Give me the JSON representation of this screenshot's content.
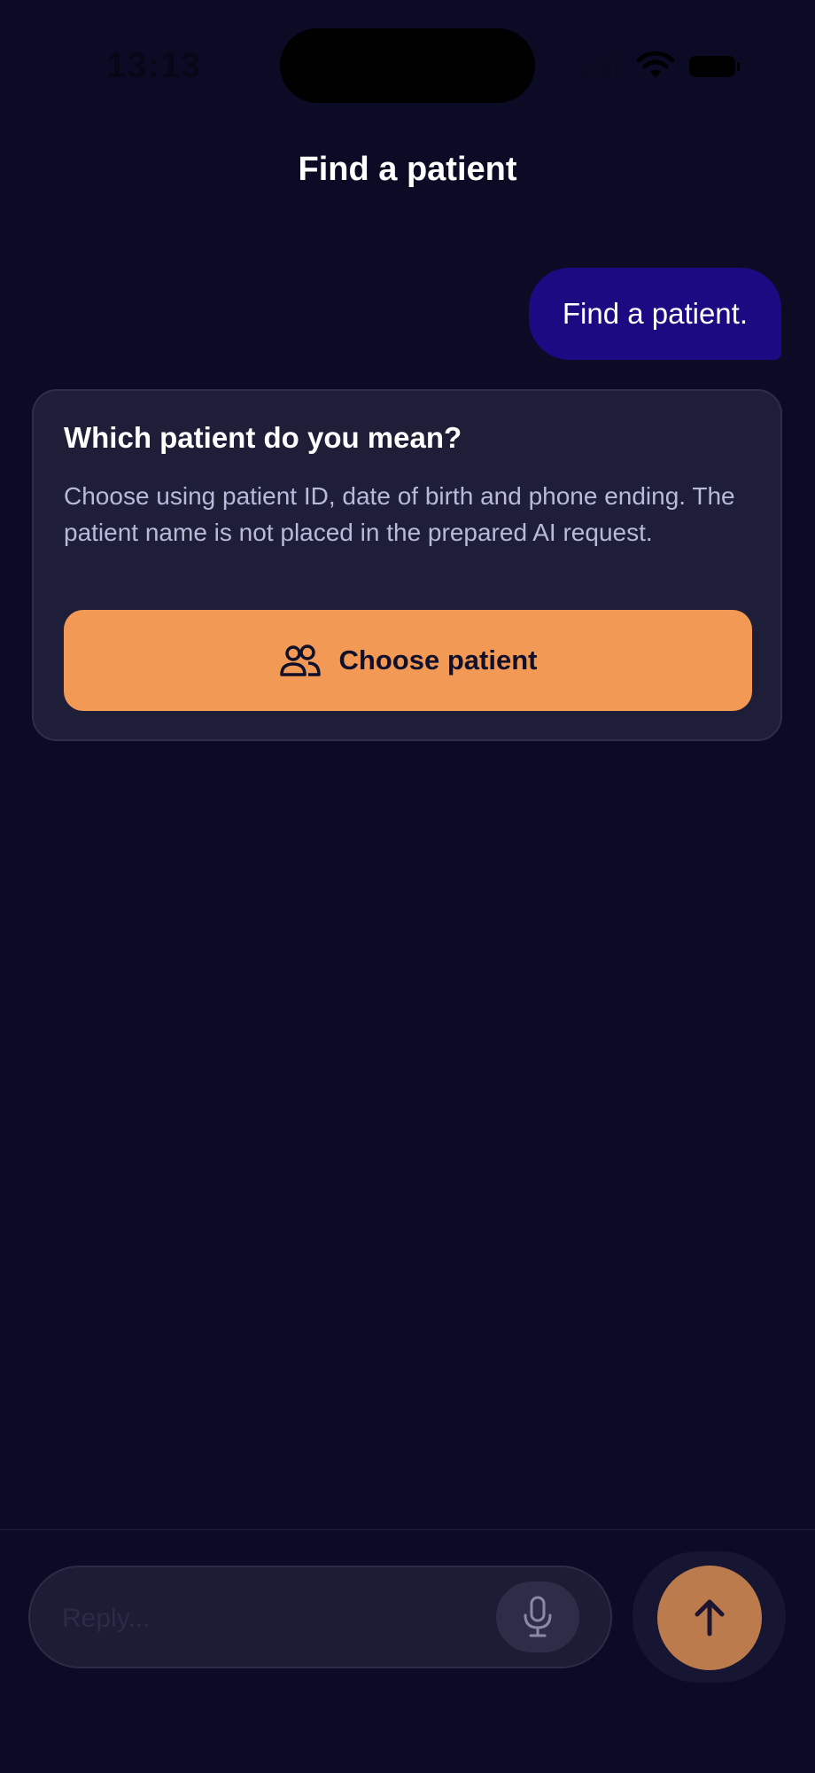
{
  "status_bar": {
    "time": "13:13"
  },
  "header": {
    "title": "Find a patient"
  },
  "conversation": {
    "user_message": "Find a patient."
  },
  "prompt_card": {
    "title": "Which patient do you mean?",
    "description": "Choose using patient ID, date of birth and phone ending. The patient name is not placed in the prepared AI request.",
    "button_label": "Choose patient",
    "button_icon": "users-icon"
  },
  "composer": {
    "placeholder": "Reply...",
    "value": "",
    "mic_icon": "microphone-icon",
    "send_icon": "arrow-up-icon"
  },
  "colors": {
    "background": "#0b0b26",
    "user_bubble": "#1b0a82",
    "card": "#1e1e38",
    "accent": "#f29a55",
    "send_button": "#bb7b4c"
  }
}
